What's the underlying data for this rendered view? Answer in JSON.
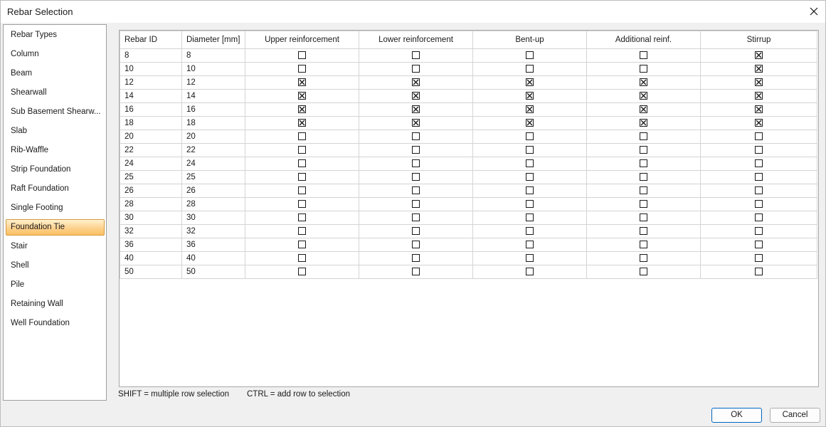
{
  "window": {
    "title": "Rebar Selection"
  },
  "sidebar": {
    "items": [
      {
        "label": "Rebar Types"
      },
      {
        "label": "Column"
      },
      {
        "label": "Beam"
      },
      {
        "label": "Shearwall"
      },
      {
        "label": "Sub Basement Shearw..."
      },
      {
        "label": "Slab"
      },
      {
        "label": "Rib-Waffle"
      },
      {
        "label": "Strip Foundation"
      },
      {
        "label": "Raft Foundation"
      },
      {
        "label": "Single Footing"
      },
      {
        "label": "Foundation Tie"
      },
      {
        "label": "Stair"
      },
      {
        "label": "Shell"
      },
      {
        "label": "Pile"
      },
      {
        "label": "Retaining Wall"
      },
      {
        "label": "Well Foundation"
      }
    ],
    "selected": "Foundation Tie"
  },
  "grid": {
    "columns": [
      "Rebar ID",
      "Diameter [mm]",
      "Upper reinforcement",
      "Lower reinforcement",
      "Bent-up",
      "Additional reinf.",
      "Stirrup"
    ],
    "rows": [
      {
        "id": "8",
        "diameter": "8",
        "checks": [
          false,
          false,
          false,
          false,
          true
        ]
      },
      {
        "id": "10",
        "diameter": "10",
        "checks": [
          false,
          false,
          false,
          false,
          true
        ]
      },
      {
        "id": "12",
        "diameter": "12",
        "checks": [
          true,
          true,
          true,
          true,
          true
        ]
      },
      {
        "id": "14",
        "diameter": "14",
        "checks": [
          true,
          true,
          true,
          true,
          true
        ]
      },
      {
        "id": "16",
        "diameter": "16",
        "checks": [
          true,
          true,
          true,
          true,
          true
        ]
      },
      {
        "id": "18",
        "diameter": "18",
        "checks": [
          true,
          true,
          true,
          true,
          true
        ]
      },
      {
        "id": "20",
        "diameter": "20",
        "checks": [
          false,
          false,
          false,
          false,
          false
        ]
      },
      {
        "id": "22",
        "diameter": "22",
        "checks": [
          false,
          false,
          false,
          false,
          false
        ]
      },
      {
        "id": "24",
        "diameter": "24",
        "checks": [
          false,
          false,
          false,
          false,
          false
        ]
      },
      {
        "id": "25",
        "diameter": "25",
        "checks": [
          false,
          false,
          false,
          false,
          false
        ]
      },
      {
        "id": "26",
        "diameter": "26",
        "checks": [
          false,
          false,
          false,
          false,
          false
        ]
      },
      {
        "id": "28",
        "diameter": "28",
        "checks": [
          false,
          false,
          false,
          false,
          false
        ]
      },
      {
        "id": "30",
        "diameter": "30",
        "checks": [
          false,
          false,
          false,
          false,
          false
        ]
      },
      {
        "id": "32",
        "diameter": "32",
        "checks": [
          false,
          false,
          false,
          false,
          false
        ]
      },
      {
        "id": "36",
        "diameter": "36",
        "checks": [
          false,
          false,
          false,
          false,
          false
        ]
      },
      {
        "id": "40",
        "diameter": "40",
        "checks": [
          false,
          false,
          false,
          false,
          false
        ]
      },
      {
        "id": "50",
        "diameter": "50",
        "checks": [
          false,
          false,
          false,
          false,
          false
        ]
      }
    ]
  },
  "hints": {
    "shift": "SHIFT = multiple row selection",
    "ctrl": "CTRL = add row to selection"
  },
  "buttons": {
    "ok": "OK",
    "cancel": "Cancel"
  },
  "icons": {
    "close": "close-icon",
    "checkbox_checked": "checkbox-checked-icon",
    "checkbox_unchecked": "checkbox-unchecked-icon"
  },
  "colors": {
    "selection_gradient_top": "#fff1cf",
    "selection_gradient_bottom": "#fbbf63",
    "ok_border": "#0067c0"
  }
}
